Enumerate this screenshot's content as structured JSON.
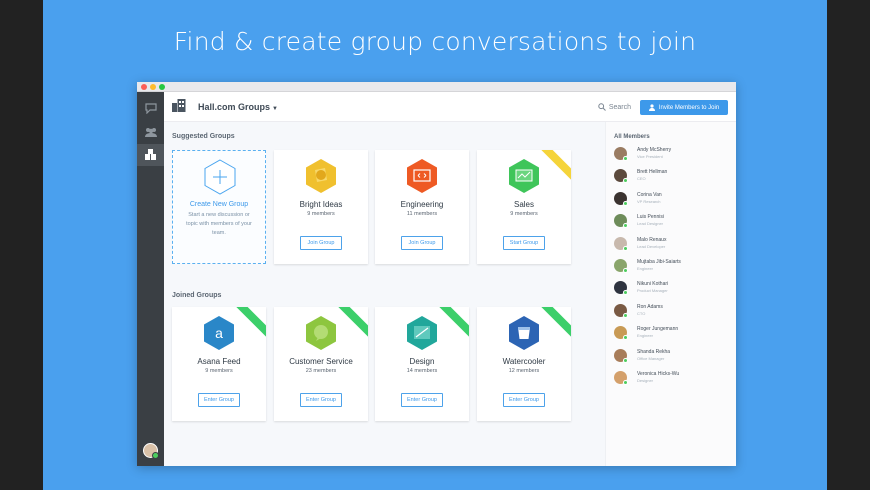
{
  "headline": "Find & create group conversations to join",
  "header": {
    "title": "Hall.com Groups",
    "search_label": "Search",
    "invite_label": "Invite Members to Join"
  },
  "suggested": {
    "title": "Suggested Groups",
    "create": {
      "name": "Create New Group",
      "desc": "Start a new discussion or topic with members of your team."
    },
    "cards": [
      {
        "name": "Bright Ideas",
        "members": "9 members",
        "button": "Join Group",
        "color": "#f0c02e",
        "icon": "lightbulb-icon"
      },
      {
        "name": "Engineering",
        "members": "11 members",
        "button": "Join Group",
        "color": "#ee5a24",
        "icon": "code-icon"
      },
      {
        "name": "Sales",
        "members": "9 members",
        "button": "Start Group",
        "color": "#3fc55a",
        "icon": "sales-icon",
        "ribbon": "",
        "ribbon_color": "#f5d43a"
      }
    ]
  },
  "joined": {
    "title": "Joined Groups",
    "cards": [
      {
        "name": "Asana Feed",
        "members": "9 members",
        "button": "Enter Group",
        "color": "#2a87c8",
        "icon": "asana-icon",
        "ribbon_color": "#3ccf6a"
      },
      {
        "name": "Customer Service",
        "members": "23 members",
        "button": "Enter Group",
        "color": "#8dc63f",
        "icon": "chat-bubble-icon",
        "ribbon_color": "#3ccf6a"
      },
      {
        "name": "Design",
        "members": "14 members",
        "button": "Enter Group",
        "color": "#21a79b",
        "icon": "design-icon",
        "ribbon_color": "#3ccf6a"
      },
      {
        "name": "Watercooler",
        "members": "12 members",
        "button": "Enter Group",
        "color": "#2c64b4",
        "icon": "cup-icon",
        "ribbon_color": "#3ccf6a"
      }
    ]
  },
  "members": {
    "title": "All Members",
    "list": [
      {
        "name": "Andy McSherry",
        "role": "Vice President",
        "avatar_color": "#9a7c62"
      },
      {
        "name": "Brett Hellman",
        "role": "CEO",
        "avatar_color": "#5c4a3d"
      },
      {
        "name": "Corina Van",
        "role": "VP Research",
        "avatar_color": "#3b3330"
      },
      {
        "name": "Luis Pennisi",
        "role": "Lead Designer",
        "avatar_color": "#6e8c5a"
      },
      {
        "name": "Malo Renaux",
        "role": "Lead Developer",
        "avatar_color": "#c8b9ad"
      },
      {
        "name": "Mujtaba Jibi-Saiarts",
        "role": "Engineer",
        "avatar_color": "#8aa56b"
      },
      {
        "name": "Nikuni Kothari",
        "role": "Product Manager",
        "avatar_color": "#2f3440"
      },
      {
        "name": "Ron Adams",
        "role": "CTO",
        "avatar_color": "#7a5a44"
      },
      {
        "name": "Roger Jungemann",
        "role": "Engineer",
        "avatar_color": "#c89a55"
      },
      {
        "name": "Shanda Rekha",
        "role": "Office Manager",
        "avatar_color": "#a87d5a"
      },
      {
        "name": "Veronica Hicks-Wu",
        "role": "Designer",
        "avatar_color": "#d4a06b"
      }
    ]
  }
}
